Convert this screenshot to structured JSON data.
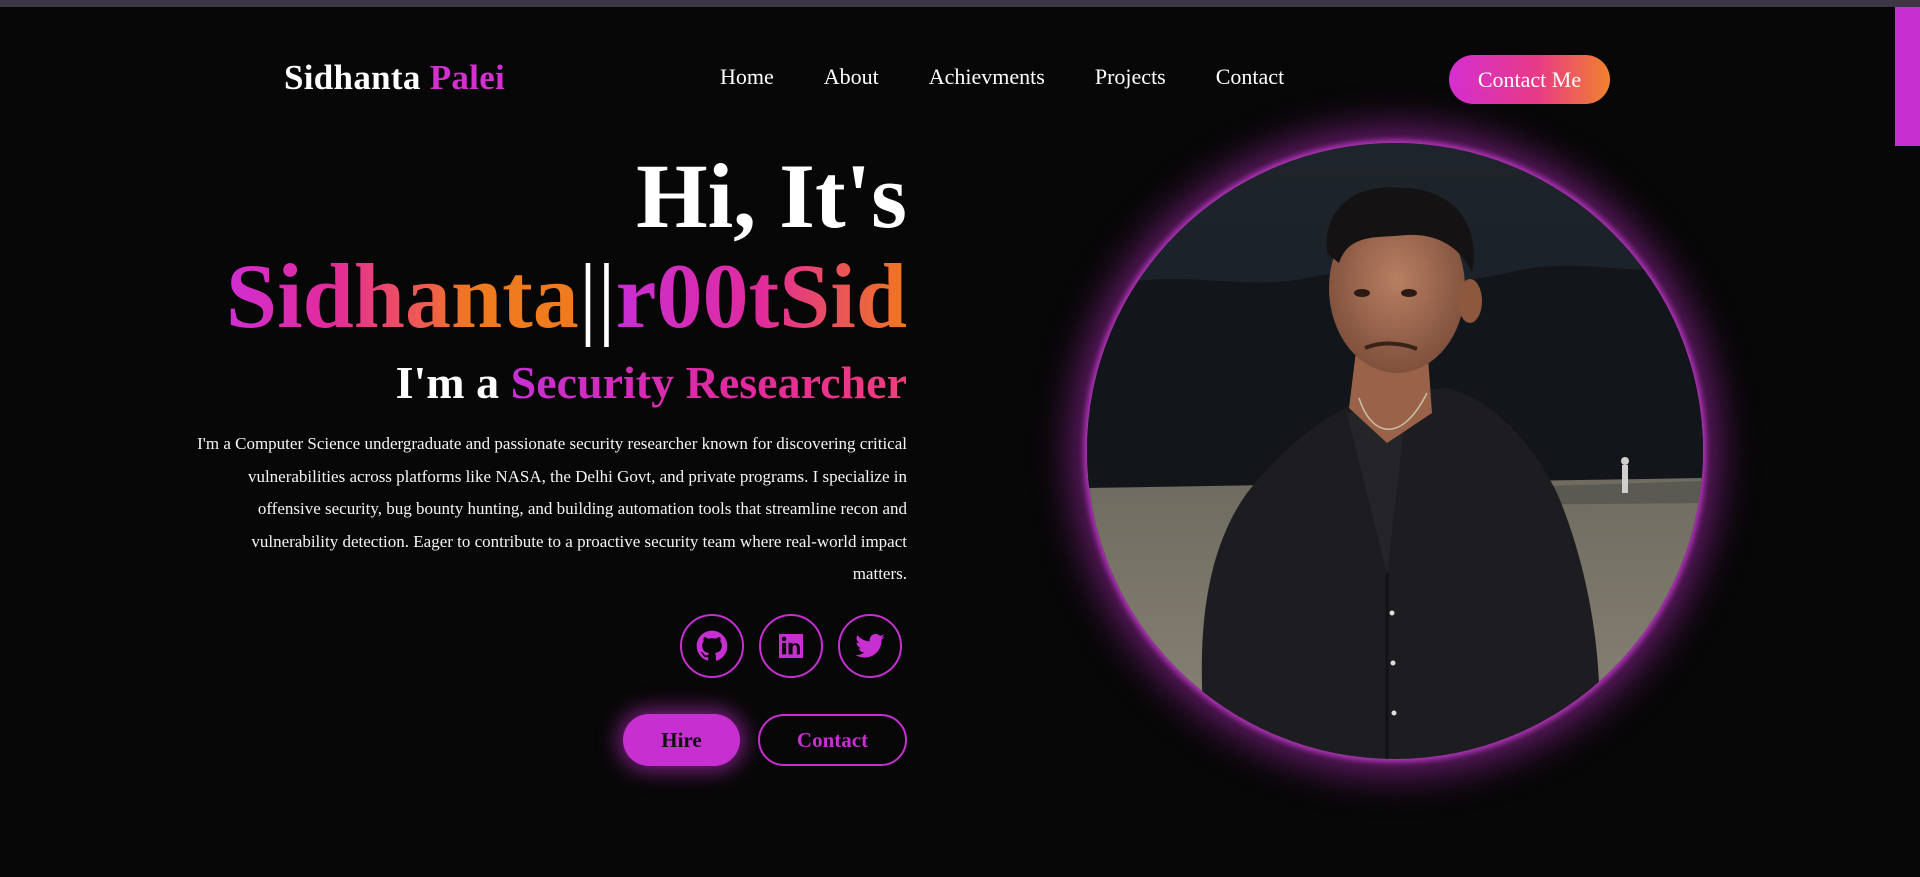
{
  "header": {
    "logo_first": "Sidhanta",
    "logo_last": "Palei",
    "nav": [
      "Home",
      "About",
      "Achievments",
      "Projects",
      "Contact"
    ],
    "cta": "Contact Me"
  },
  "hero": {
    "greeting": "Hi, It's",
    "name_primary": "Sidhanta",
    "name_separator": "||",
    "name_handle": "r00tSid",
    "role_prefix": "I'm a",
    "role_title": "Security Researcher",
    "bio": "I'm a Computer Science undergraduate and passionate security researcher known for discovering critical vulnerabilities across platforms like NASA, the Delhi Govt, and private programs. I specialize in offensive security, bug bounty hunting, and building automation tools that streamline recon and vulnerability detection. Eager to contribute to a proactive security team where real-world impact matters.",
    "socials": [
      {
        "icon": "github-icon"
      },
      {
        "icon": "linkedin-icon"
      },
      {
        "icon": "twitter-icon"
      }
    ],
    "hire_label": "Hire",
    "contact_label": "Contact"
  },
  "colors": {
    "background": "#070707",
    "accent": "#c62fd0",
    "gradient_pink": "#e32a9a",
    "gradient_orange": "#f07a1e"
  }
}
